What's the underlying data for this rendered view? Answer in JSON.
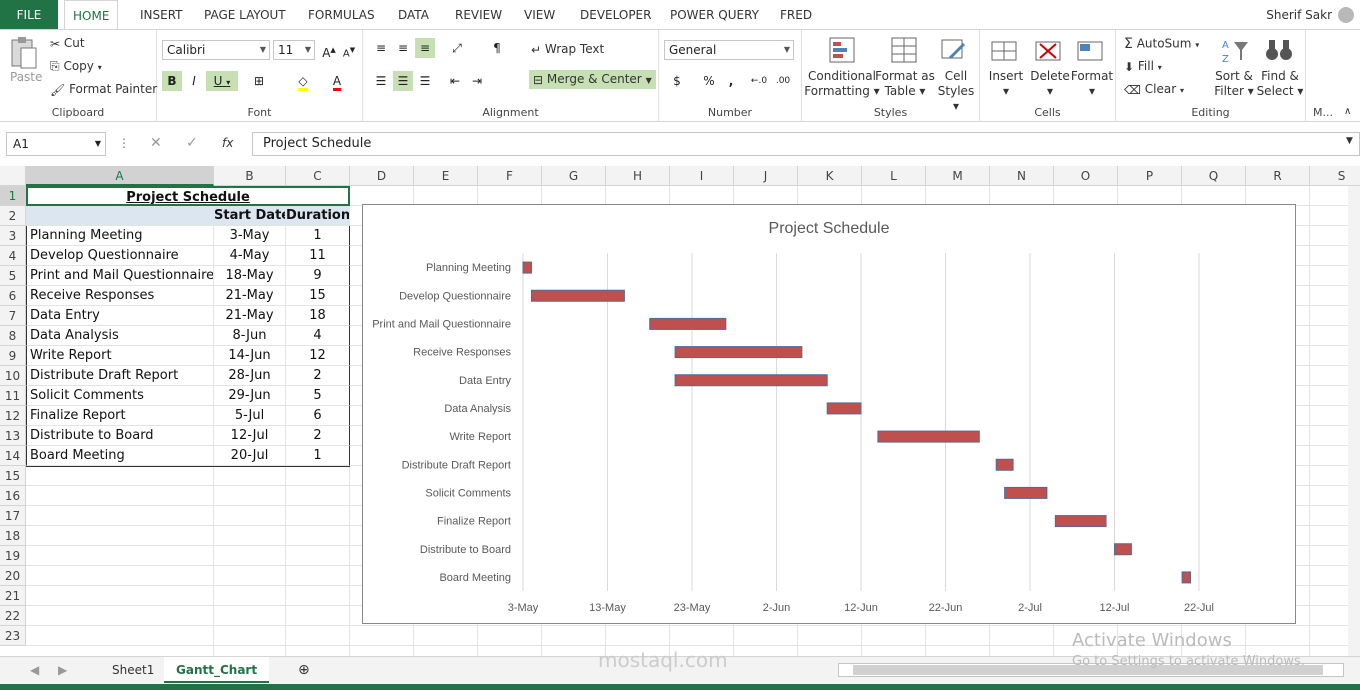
{
  "ribbon_tabs": [
    "FILE",
    "HOME",
    "INSERT",
    "PAGE LAYOUT",
    "FORMULAS",
    "DATA",
    "REVIEW",
    "VIEW",
    "DEVELOPER",
    "POWER QUERY",
    "FRED"
  ],
  "user_name": "Sherif Sakr",
  "clipboard": {
    "paste": "Paste",
    "cut": "Cut",
    "copy": "Copy",
    "format_painter": "Format Painter",
    "label": "Clipboard"
  },
  "font": {
    "name": "Calibri",
    "size": "11",
    "bold": "B",
    "italic": "I",
    "underline": "U",
    "label": "Font"
  },
  "alignment": {
    "wrap_text": "Wrap Text",
    "merge_center": "Merge & Center",
    "label": "Alignment"
  },
  "number": {
    "format": "General",
    "currency": "$",
    "percent": "%",
    "comma": ",",
    "label": "Number"
  },
  "styles": {
    "conditional": "Conditional",
    "conditional2": "Formatting",
    "format_as": "Format as",
    "format_as2": "Table",
    "cell": "Cell",
    "cell2": "Styles",
    "label": "Styles"
  },
  "cells": {
    "insert": "Insert",
    "delete": "Delete",
    "format": "Format",
    "label": "Cells"
  },
  "editing": {
    "autosum": "AutoSum",
    "fill": "Fill",
    "clear": "Clear",
    "sort": "Sort &",
    "sort2": "Filter",
    "find": "Find &",
    "find2": "Select",
    "label": "Editing",
    "extra": "M..."
  },
  "formula_bar": {
    "name_box": "A1",
    "formula": "Project Schedule",
    "fx": "fx"
  },
  "columns": [
    "A",
    "B",
    "C",
    "D",
    "E",
    "F",
    "G",
    "H",
    "I",
    "J",
    "K",
    "L",
    "M",
    "N",
    "O",
    "P",
    "Q",
    "R",
    "S"
  ],
  "rows": [
    "1",
    "2",
    "3",
    "4",
    "5",
    "6",
    "7",
    "8",
    "9",
    "10",
    "11",
    "12",
    "13",
    "14",
    "15",
    "16",
    "17",
    "18",
    "19",
    "20",
    "21",
    "22",
    "23"
  ],
  "table": {
    "title": "Project Schedule",
    "headers": [
      "",
      "Start Date",
      "Duration"
    ],
    "tasks": [
      {
        "name": "Planning Meeting",
        "start": "3-May",
        "duration": "1"
      },
      {
        "name": "Develop Questionnaire",
        "start": "4-May",
        "duration": "11"
      },
      {
        "name": "Print and Mail Questionnaire",
        "start": "18-May",
        "duration": "9"
      },
      {
        "name": "Receive Responses",
        "start": "21-May",
        "duration": "15"
      },
      {
        "name": "Data Entry",
        "start": "21-May",
        "duration": "18"
      },
      {
        "name": "Data Analysis",
        "start": "8-Jun",
        "duration": "4"
      },
      {
        "name": "Write Report",
        "start": "14-Jun",
        "duration": "12"
      },
      {
        "name": "Distribute Draft Report",
        "start": "28-Jun",
        "duration": "2"
      },
      {
        "name": "Solicit Comments",
        "start": "29-Jun",
        "duration": "5"
      },
      {
        "name": "Finalize Report",
        "start": "5-Jul",
        "duration": "6"
      },
      {
        "name": "Distribute to Board",
        "start": "12-Jul",
        "duration": "2"
      },
      {
        "name": "Board Meeting",
        "start": "20-Jul",
        "duration": "1"
      }
    ]
  },
  "chart_data": {
    "type": "bar",
    "title": "Project Schedule",
    "orientation": "horizontal-gantt",
    "categories": [
      "Planning Meeting",
      "Develop Questionnaire",
      "Print and Mail Questionnaire",
      "Receive Responses",
      "Data Entry",
      "Data Analysis",
      "Write Report",
      "Distribute Draft Report",
      "Solicit Comments",
      "Finalize Report",
      "Distribute to Board",
      "Board Meeting"
    ],
    "starts": [
      "3-May",
      "4-May",
      "18-May",
      "21-May",
      "21-May",
      "8-Jun",
      "14-Jun",
      "28-Jun",
      "29-Jun",
      "5-Jul",
      "12-Jul",
      "20-Jul"
    ],
    "durations": [
      1,
      11,
      9,
      15,
      18,
      4,
      12,
      2,
      5,
      6,
      2,
      1
    ],
    "x_ticks": [
      "3-May",
      "13-May",
      "23-May",
      "2-Jun",
      "12-Jun",
      "22-Jun",
      "2-Jul",
      "12-Jul",
      "22-Jul"
    ],
    "grid": true,
    "bar_color": "#c0504d"
  },
  "sheets": [
    "Sheet1",
    "Gantt_Chart"
  ],
  "overlay": {
    "activate": "Activate Windows",
    "activate_sub": "Go to Settings to activate Windows.",
    "watermark": "mostaql.com"
  }
}
